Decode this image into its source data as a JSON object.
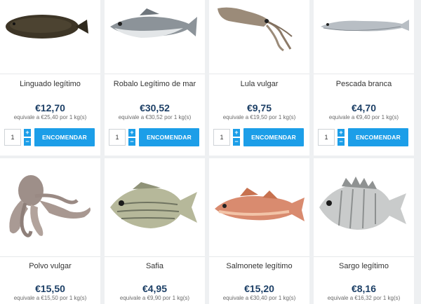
{
  "order_label": "ENCOMENDAR",
  "default_qty": "1",
  "stepper": {
    "plus": "+",
    "minus": "−"
  },
  "products": [
    {
      "name": "Linguado legítimo",
      "price": "€12,70",
      "equiv": "equivale a €25,40 por 1 kg(s)",
      "icon": "sole-fish"
    },
    {
      "name": "Robalo Legítimo de mar",
      "price": "€30,52",
      "equiv": "equivale a €30,52 por 1 kg(s)",
      "icon": "sea-bass"
    },
    {
      "name": "Lula vulgar",
      "price": "€9,75",
      "equiv": "equivale a €19,50 por 1 kg(s)",
      "icon": "squid"
    },
    {
      "name": "Pescada branca",
      "price": "€4,70",
      "equiv": "equivale a €9,40 por 1 kg(s)",
      "icon": "hake"
    },
    {
      "name": "Polvo vulgar",
      "price": "€15,50",
      "equiv": "equivale a €15,50 por 1 kg(s)",
      "icon": "octopus"
    },
    {
      "name": "Safia",
      "price": "€4,95",
      "equiv": "equivale a €9,90 por 1 kg(s)",
      "icon": "sea-bream"
    },
    {
      "name": "Salmonete legítimo",
      "price": "€15,20",
      "equiv": "equivale a €30,40 por 1 kg(s)",
      "icon": "red-mullet"
    },
    {
      "name": "Sargo legítimo",
      "price": "€8,16",
      "equiv": "equivale a €16,32 por 1 kg(s)",
      "icon": "white-seabream"
    }
  ]
}
